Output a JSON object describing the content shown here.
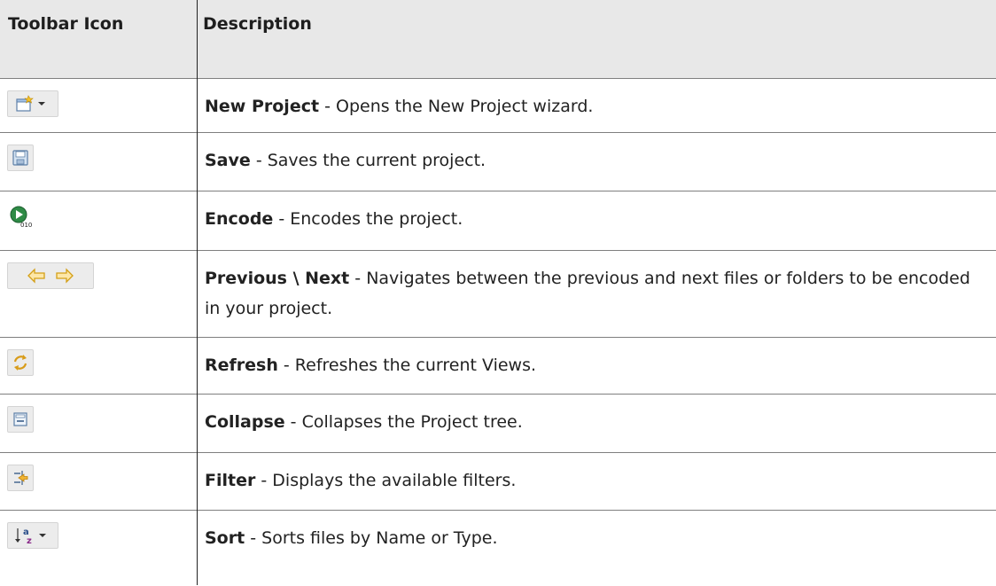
{
  "header": {
    "icon_col": "Toolbar Icon",
    "desc_col": "Description"
  },
  "rows": [
    {
      "icon": "new-project-icon",
      "has_dropdown": true,
      "name": "New Project",
      "desc": " - Opens the New Project wizard."
    },
    {
      "icon": "save-icon",
      "has_dropdown": false,
      "name": "Save",
      "desc": " - Saves the current project."
    },
    {
      "icon": "encode-icon",
      "has_dropdown": false,
      "name": "Encode",
      "desc": " - Encodes the project."
    },
    {
      "icon": "previous-next-icon",
      "has_dropdown": false,
      "name": "Previous \\ Next",
      "desc": " - Navigates between the previous and next files or folders to be encoded in your project."
    },
    {
      "icon": "refresh-icon",
      "has_dropdown": false,
      "name": "Refresh",
      "desc": " - Refreshes the current Views."
    },
    {
      "icon": "collapse-icon",
      "has_dropdown": false,
      "name": "Collapse",
      "desc": " - Collapses the Project tree."
    },
    {
      "icon": "filter-icon",
      "has_dropdown": false,
      "name": "Filter",
      "desc": " - Displays the available filters."
    },
    {
      "icon": "sort-icon",
      "has_dropdown": true,
      "name": "Sort",
      "desc": " - Sorts files by Name or Type."
    }
  ],
  "colors": {
    "header_bg": "#e8e8e8",
    "row_divider": "#7f7f7f",
    "column_divider": "#222222"
  }
}
